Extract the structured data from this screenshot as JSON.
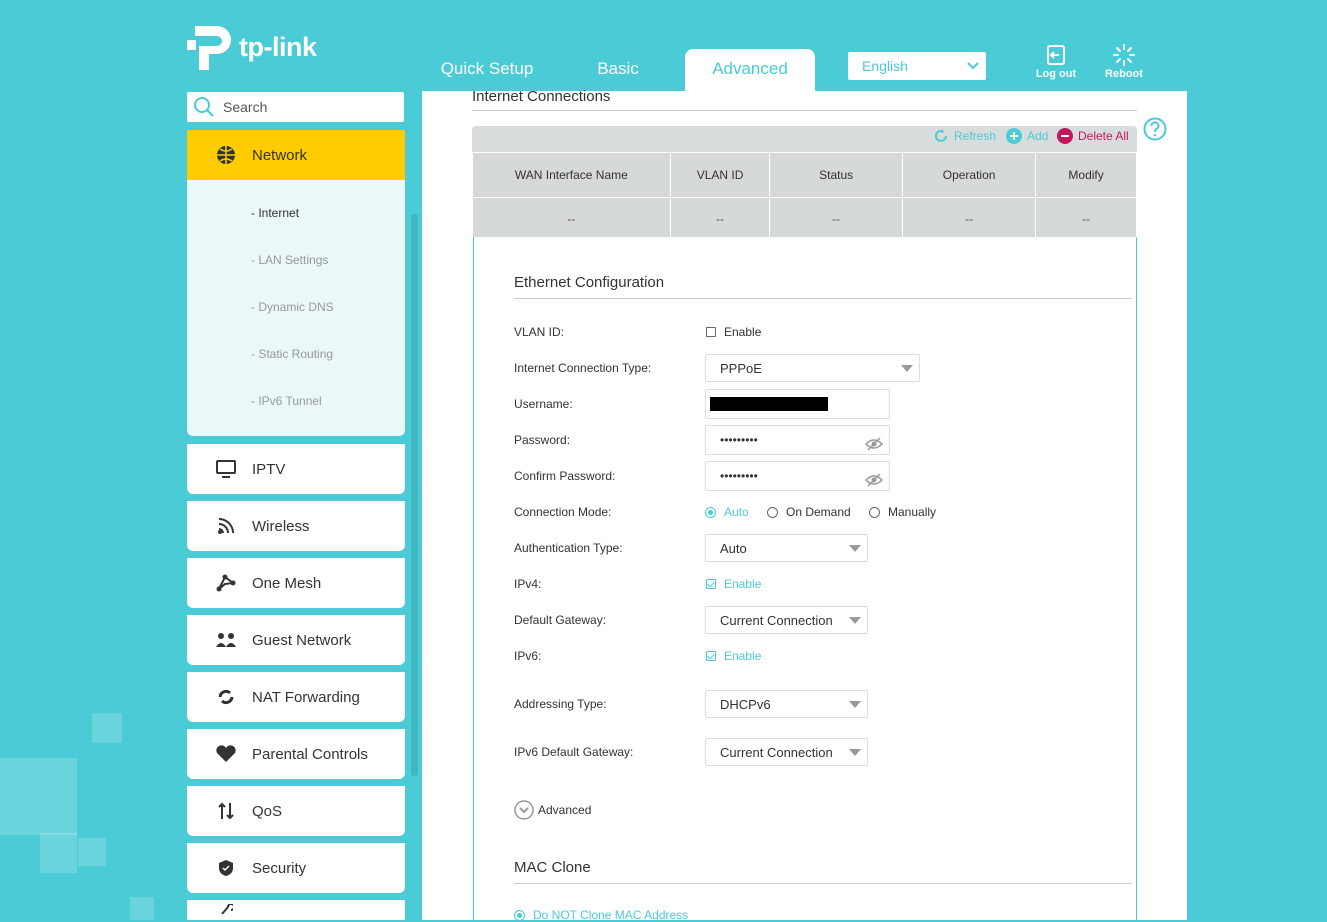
{
  "brand": {
    "logo_text": "tp-link"
  },
  "tabs": [
    {
      "label": "Quick Setup"
    },
    {
      "label": "Basic"
    },
    {
      "label": "Advanced"
    }
  ],
  "language": {
    "selected": "English"
  },
  "header_actions": {
    "logout": "Log out",
    "reboot": "Reboot"
  },
  "search": {
    "placeholder": "Search"
  },
  "sidebar": {
    "network": {
      "label": "Network",
      "subitems": [
        "- Internet",
        "- LAN Settings",
        "- Dynamic DNS",
        "- Static Routing",
        "- IPv6 Tunnel"
      ]
    },
    "items": [
      {
        "label": "IPTV"
      },
      {
        "label": "Wireless"
      },
      {
        "label": "One Mesh"
      },
      {
        "label": "Guest Network"
      },
      {
        "label": "NAT Forwarding"
      },
      {
        "label": "Parental Controls"
      },
      {
        "label": "QoS"
      },
      {
        "label": "Security"
      }
    ]
  },
  "internet_connections": {
    "title": "Internet Connections",
    "actions": {
      "refresh": "Refresh",
      "add": "Add",
      "delete_all": "Delete All"
    },
    "columns": [
      "WAN Interface Name",
      "VLAN ID",
      "Status",
      "Operation",
      "Modify"
    ],
    "row": [
      "--",
      "--",
      "--",
      "--",
      "--"
    ]
  },
  "ethernet": {
    "title": "Ethernet Configuration",
    "vlan_label": "VLAN ID:",
    "vlan_enable": "Enable",
    "conn_type_label": "Internet Connection Type:",
    "conn_type_value": "PPPoE",
    "username_label": "Username:",
    "password_label": "Password:",
    "password_value": "•••••••••",
    "confirm_label": "Confirm Password:",
    "confirm_value": "•••••••••",
    "conn_mode_label": "Connection Mode:",
    "conn_mode_options": [
      "Auto",
      "On Demand",
      "Manually"
    ],
    "auth_label": "Authentication Type:",
    "auth_value": "Auto",
    "ipv4_label": "IPv4:",
    "ipv4_enable": "Enable",
    "gateway_label": "Default Gateway:",
    "gateway_value": "Current Connection",
    "ipv6_label": "IPv6:",
    "ipv6_enable": "Enable",
    "addressing_label": "Addressing Type:",
    "addressing_value": "DHCPv6",
    "ipv6_gateway_label": "IPv6 Default Gateway:",
    "ipv6_gateway_value": "Current Connection",
    "advanced": "Advanced"
  },
  "mac_clone": {
    "title": "MAC Clone",
    "option": "Do NOT Clone MAC Address"
  },
  "colors": {
    "accent": "#4acbd6",
    "nav_active": "#ffcc00",
    "delete": "#c2185b"
  }
}
